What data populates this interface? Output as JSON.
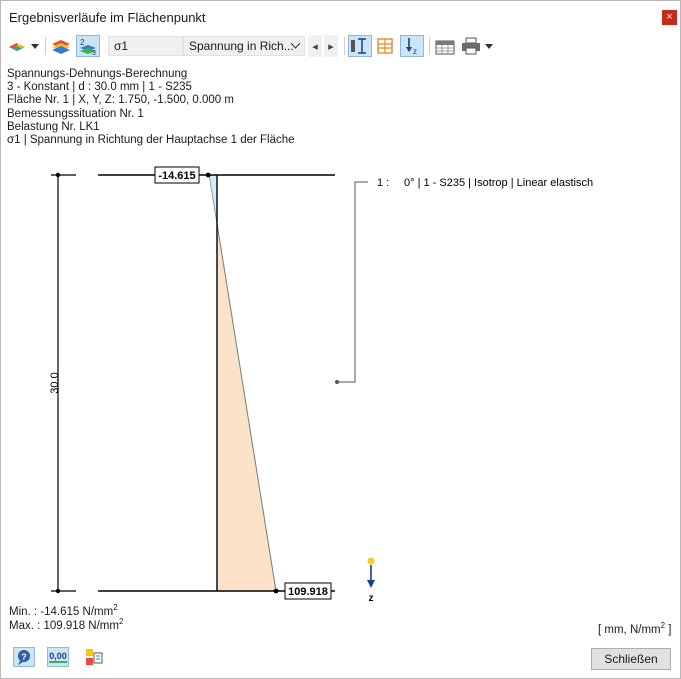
{
  "window": {
    "title": "Ergebnisverläufe im Flächenpunkt",
    "close_glyph": "×"
  },
  "toolbar": {
    "icons": [
      "surface-results-icon",
      "dropdown-arrow-icon",
      "multi-surface-icon",
      "numbered-layers-icon",
      "thickness-icon",
      "layers-grid-icon",
      "z-axis-down-icon",
      "table-export-icon",
      "print-icon",
      "dropdown-arrow-icon"
    ],
    "result_value": "σ1",
    "result_description": "Spannung in Rich...",
    "prev_glyph": "◂",
    "next_glyph": "▸"
  },
  "info": {
    "lines": [
      "Spannungs-Dehnungs-Berechnung",
      "3 - Konstant | d : 30.0 mm | 1 - S235",
      "Fläche Nr. 1 | X, Y, Z: 1.750, -1.500, 0.000 m",
      "Bemessungssituation Nr. 1",
      "Belastung Nr. LK1",
      "σ1 | Spannung in Richtung der Hauptachse 1 der Fläche"
    ]
  },
  "chart_data": {
    "type": "area",
    "thickness_label": "30.0",
    "depth_range_mm": [
      0,
      30
    ],
    "points": [
      {
        "z_mm": 0.0,
        "value": -14.615
      },
      {
        "z_mm": 30.0,
        "value": 109.918
      }
    ],
    "value_labels": [
      "-14.615",
      "109.918"
    ],
    "zero_depth_mm": 3.5,
    "layer_legend": {
      "number": "1 :",
      "text": "0° | 1 - S235 | Isotrop | Linear elastisch"
    },
    "axis_label": "z",
    "colors": {
      "negative_fill": "#d6ecf5",
      "positive_fill": "#fbe2c8",
      "axis_dot": "#f2d21b",
      "axis_arrow": "#1a3f8f"
    }
  },
  "summary": {
    "min_label": "Min. :",
    "min_value": "-14.615 N/mm",
    "max_label": "Max. :",
    "max_value": "109.918 N/mm",
    "unit_exponent": "2",
    "units_text": "[ mm, N/mm",
    "units_close": " ]"
  },
  "footer": {
    "icons": [
      "help-icon",
      "decimal-places-icon",
      "view-options-icon"
    ],
    "decimal_label": "0,00",
    "close_label": "Schließen"
  }
}
